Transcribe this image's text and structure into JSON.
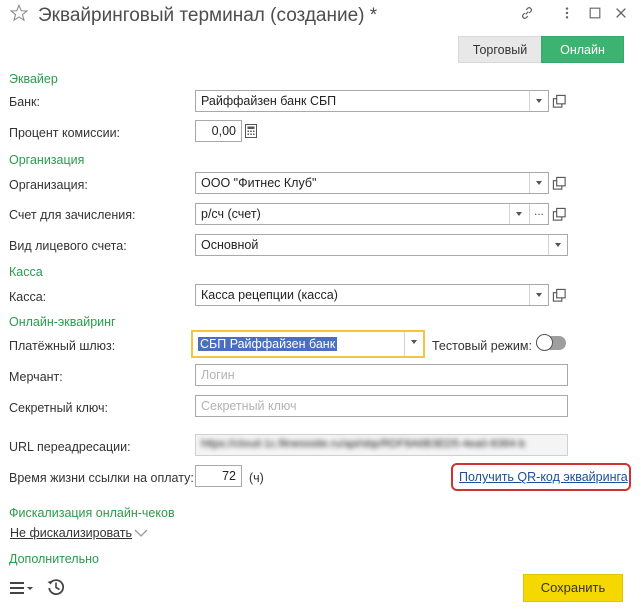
{
  "window": {
    "title": "Эквайринговый терминал (создание) *"
  },
  "modes": {
    "torg": "Торговый",
    "online": "Онлайн"
  },
  "sections": {
    "acquirer": "Эквайер",
    "organization": "Организация",
    "kassa": "Касса",
    "online_acquiring": "Онлайн-эквайринг",
    "fiscalization": "Фискализация онлайн-чеков",
    "additional": "Дополнительно"
  },
  "fields": {
    "bank": {
      "label": "Банк:",
      "value": "Райффайзен банк СБП"
    },
    "commission": {
      "label": "Процент комиссии:",
      "value": "0,00"
    },
    "org": {
      "label": "Организация:",
      "value": "ООО \"Фитнес Клуб\""
    },
    "account": {
      "label": "Счет для зачисления:",
      "value": "р/сч (счет)"
    },
    "personal_account": {
      "label": "Вид лицевого счета:",
      "value": "Основной"
    },
    "kassa": {
      "label": "Касса:",
      "value": "Касса рецепции (касса)"
    },
    "gateway": {
      "label": "Платёжный шлюз:",
      "value": "СБП Райффайзен банк"
    },
    "test_mode": {
      "label": "Тестовый режим:"
    },
    "merchant": {
      "label": "Мерчант:",
      "placeholder": "Логин"
    },
    "secret": {
      "label": "Секретный ключ:",
      "placeholder": "Секретный ключ"
    },
    "redirect_url": {
      "label": "URL переадресации:",
      "value": "https://cloud-1c.fitnesssite.ru/api/sbp/RDF8A6B3ED5-4ea0-8384-b"
    },
    "link_ttl": {
      "label": "Время жизни ссылки на оплату:",
      "value": "72",
      "unit": "(ч)"
    }
  },
  "qr_link": "Получить QR-код эквайринга",
  "fiscal_option": "Не фискализировать",
  "save_label": "Сохранить",
  "colors": {
    "section_green": "#2a9b4c",
    "online_active": "#3cb371",
    "save_yellow": "#f5d800",
    "focus_border": "#f5c542",
    "qr_highlight": "#cc3333"
  }
}
